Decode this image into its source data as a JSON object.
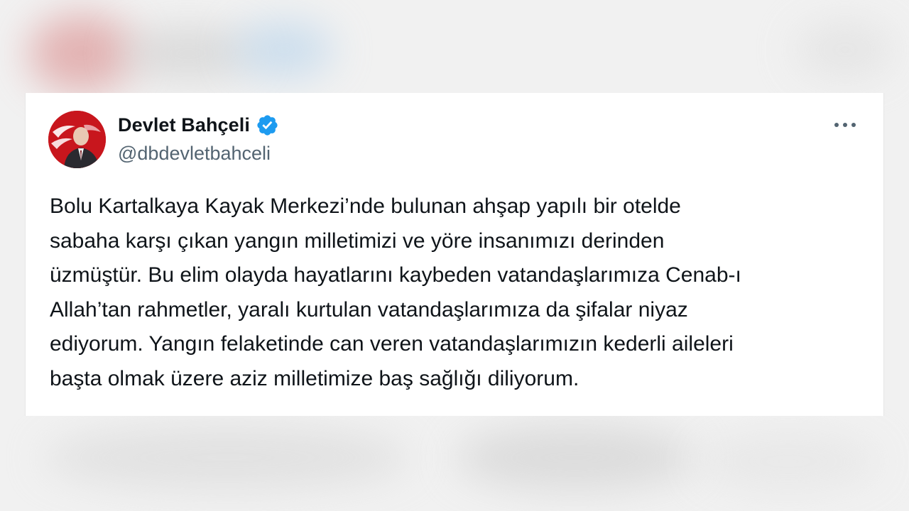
{
  "tweet": {
    "author": {
      "display_name": "Devlet Bahçeli",
      "handle": "@dbdevletbahceli",
      "verified": true
    },
    "more_icon": "more-horizontal-icon",
    "text_lines": [
      "Bolu Kartalkaya Kayak Merkezi’nde bulunan ahşap yapılı bir otelde",
      "sabaha karşı çıkan yangın milletimizi ve yöre insanımızı derinden",
      "üzmüştür. Bu elim olayda hayatlarını kaybeden vatandaşlarımıza Cenab-ı",
      "Allah’tan rahmetler, yaralı kurtulan vatandaşlarımıza da şifalar niyaz",
      "ediyorum. Yangın felaketinde can veren vatandaşlarımızın kederli aileleri",
      "başta olmak üzere aziz milletimize baş sağlığı diliyorum."
    ]
  },
  "colors": {
    "verified_badge": "#1d9bf0",
    "text_primary": "#0f1419",
    "text_secondary": "#536471",
    "avatar_background": "#c8161d"
  }
}
